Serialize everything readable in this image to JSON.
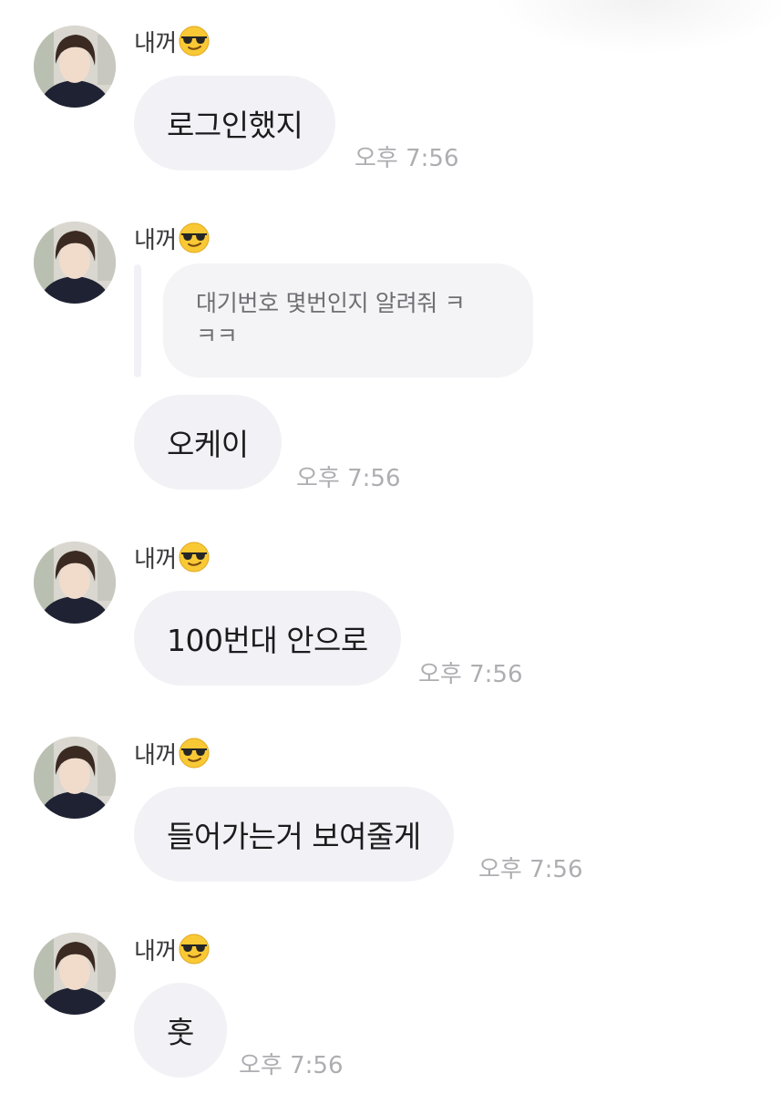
{
  "messages": [
    {
      "sender": "내꺼",
      "sender_emoji": "sunglasses-emoji",
      "text": "로그인했지",
      "time": "오후 7:56"
    },
    {
      "sender": "내꺼",
      "sender_emoji": "sunglasses-emoji",
      "reply_to": {
        "line1": "대기번호 몇번인지 알려줘 ㅋ",
        "line2": "ㅋㅋ"
      },
      "text": "오케이",
      "time": "오후 7:56"
    },
    {
      "sender": "내꺼",
      "sender_emoji": "sunglasses-emoji",
      "text": "100번대 안으로",
      "time": "오후 7:56"
    },
    {
      "sender": "내꺼",
      "sender_emoji": "sunglasses-emoji",
      "text": "들어가는거 보여줄게",
      "time": "오후 7:56"
    },
    {
      "sender": "내꺼",
      "sender_emoji": "sunglasses-emoji",
      "text": "훗",
      "time": "오후 7:56"
    }
  ],
  "colors": {
    "bubble": "#f2f2f6",
    "text": "#1c1c1e",
    "time": "#aeaeb2",
    "reply_text": "#6e6e73"
  }
}
